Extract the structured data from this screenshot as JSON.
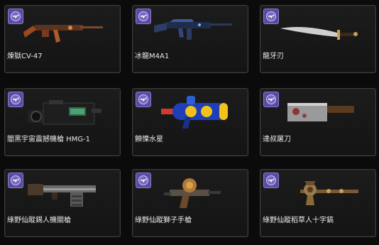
{
  "items": [
    {
      "name": "煉獄CV-47",
      "icon": "ak47-rifle-icon"
    },
    {
      "name": "冰龍M4A1",
      "icon": "m4a1-rifle-icon"
    },
    {
      "name": "龍牙刃",
      "icon": "dagger-icon"
    },
    {
      "name": "闇黑宇宙震撼機槍 HMG-1",
      "icon": "heavy-machine-gun-icon"
    },
    {
      "name": "顫慄水星",
      "icon": "water-gun-icon"
    },
    {
      "name": "達叔屠刀",
      "icon": "cleaver-icon"
    },
    {
      "name": "綠野仙蹤錫人機關槍",
      "icon": "gatling-gun-icon"
    },
    {
      "name": "綠野仙蹤獅子手槍",
      "icon": "lion-pistol-icon"
    },
    {
      "name": "綠野仙蹤稻草人十字鎬",
      "icon": "pickaxe-icon"
    }
  ],
  "badge_icon": "revolver-icon",
  "colors": {
    "badge_bg": "#5b4aa0",
    "card_border": "#3c3c3c",
    "label_text": "#e9e9e9"
  }
}
